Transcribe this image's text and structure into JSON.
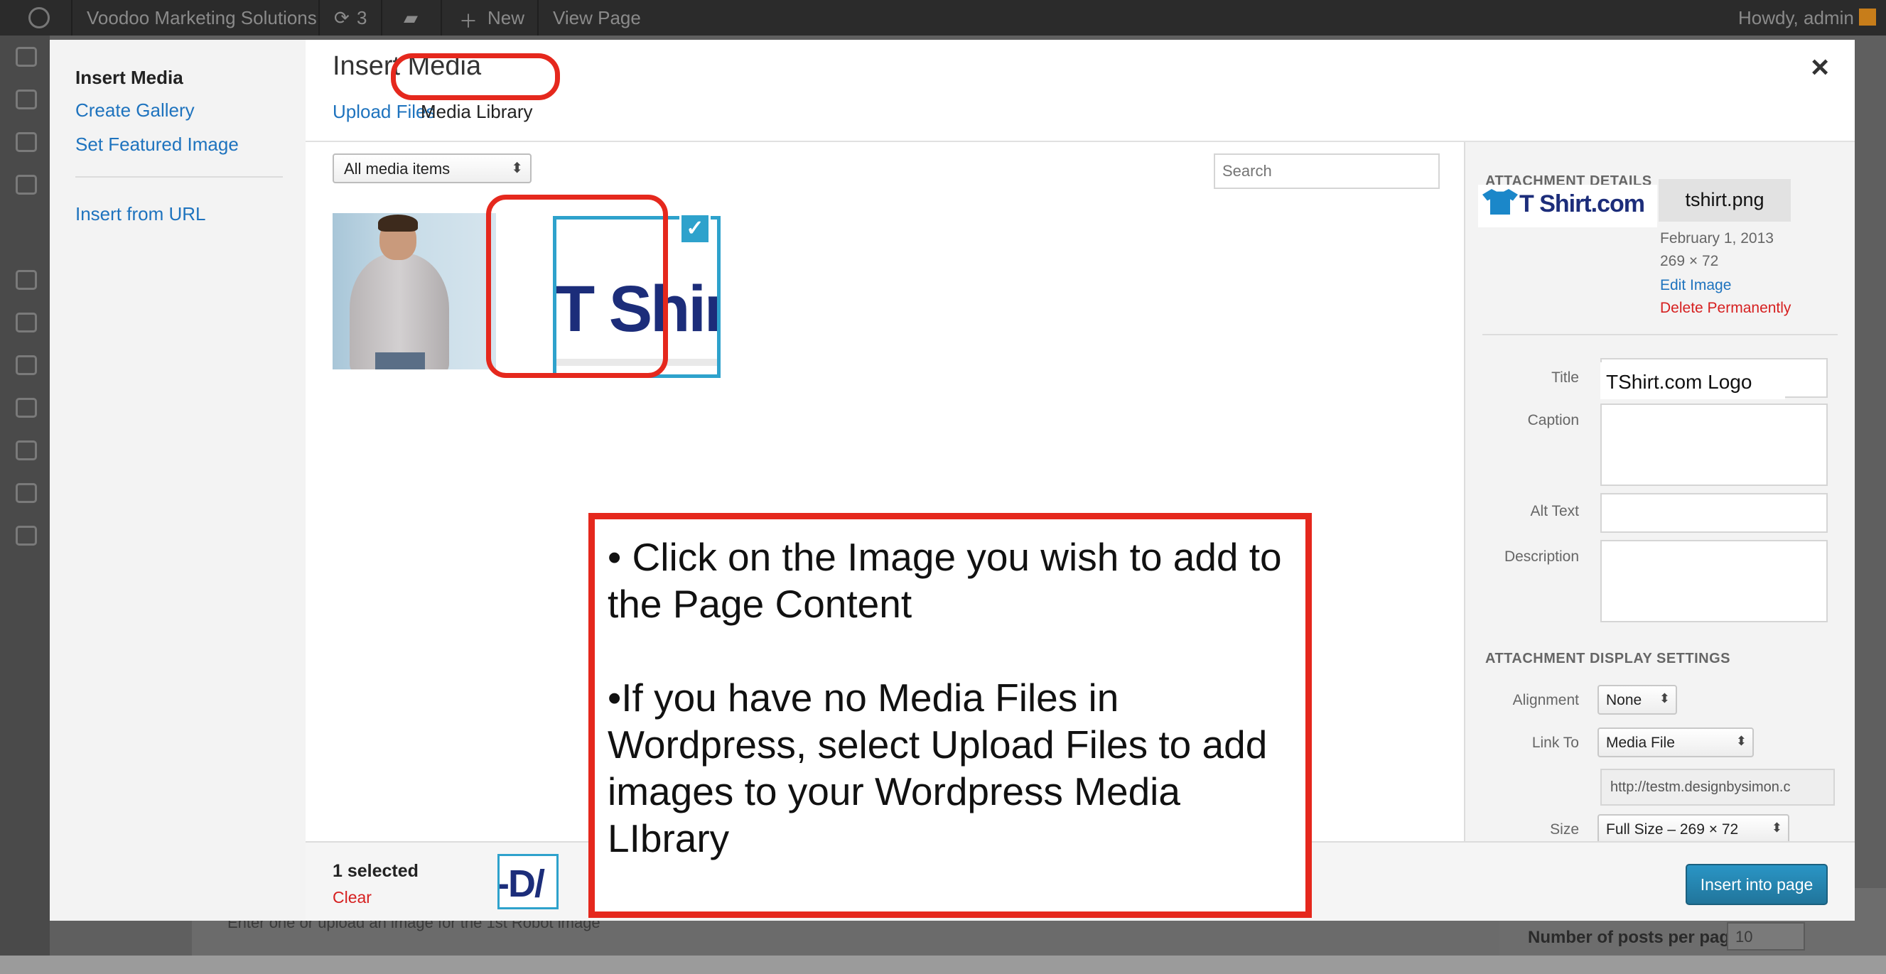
{
  "admin_bar": {
    "site_name": "Voodoo Marketing Solutions",
    "updates_count": "3",
    "new_label": "New",
    "view_page_label": "View Page",
    "howdy": "Howdy, admin"
  },
  "background": {
    "hint_text": "Enter one or upload an image for the 1st Robot image",
    "posts_per_page_label": "Number of posts per page:",
    "posts_per_page_value": "10"
  },
  "modal": {
    "menu": {
      "items": [
        "Insert Media",
        "Create Gallery",
        "Set Featured Image",
        "Insert from URL"
      ],
      "active": "Insert Media"
    },
    "title": "Insert Media",
    "close_glyph": "×",
    "tabs": {
      "upload": "Upload Files",
      "library": "Media Library",
      "active": "Media Library"
    },
    "filter": {
      "selected": "All media items"
    },
    "search": {
      "placeholder": "Search"
    },
    "attachments": [
      {
        "alt": "Hoodie model photo",
        "selected": false
      },
      {
        "alt": "T Shirt.com logo",
        "thumb_text": "T Shir",
        "selected": true
      }
    ],
    "details": {
      "heading": "ATTACHMENT DETAILS",
      "logo_text": "T Shirt.com",
      "filename": "tshirt.png",
      "date": "February 1, 2013",
      "dimensions": "269 × 72",
      "edit_label": "Edit Image",
      "delete_label": "Delete Permanently",
      "fields": {
        "title_label": "Title",
        "title_value": "TShirt.com Logo",
        "caption_label": "Caption",
        "caption_value": "",
        "alt_label": "Alt Text",
        "alt_value": "",
        "description_label": "Description",
        "description_value": ""
      }
    },
    "display_settings": {
      "heading": "ATTACHMENT DISPLAY SETTINGS",
      "alignment_label": "Alignment",
      "alignment_value": "None",
      "link_to_label": "Link To",
      "link_to_value": "Media File",
      "url": "http://testm.designbysimon.c",
      "size_label": "Size",
      "size_value": "Full Size – 269 × 72"
    },
    "toolbar": {
      "selected_count": "1 selected",
      "clear_label": "Clear",
      "mini_thumb_text": "-D/",
      "insert_label": "Insert into page"
    }
  },
  "annotation": {
    "bullet_1": "• Click on the Image you wish to add to the Page Content",
    "bullet_2": "•If you have no Media Files in Wordpress, select Upload Files to add images to your Wordpress Media LIbrary"
  },
  "colors": {
    "accent": "#2ea2cc",
    "link": "#1e73be",
    "annotation_red": "#e5281d",
    "delete_red": "#d62020"
  },
  "icons": [
    "wordpress-logo-icon",
    "updates-icon",
    "comments-icon",
    "plus-icon",
    "close-icon",
    "checkmark-icon",
    "select-arrows-icon"
  ]
}
